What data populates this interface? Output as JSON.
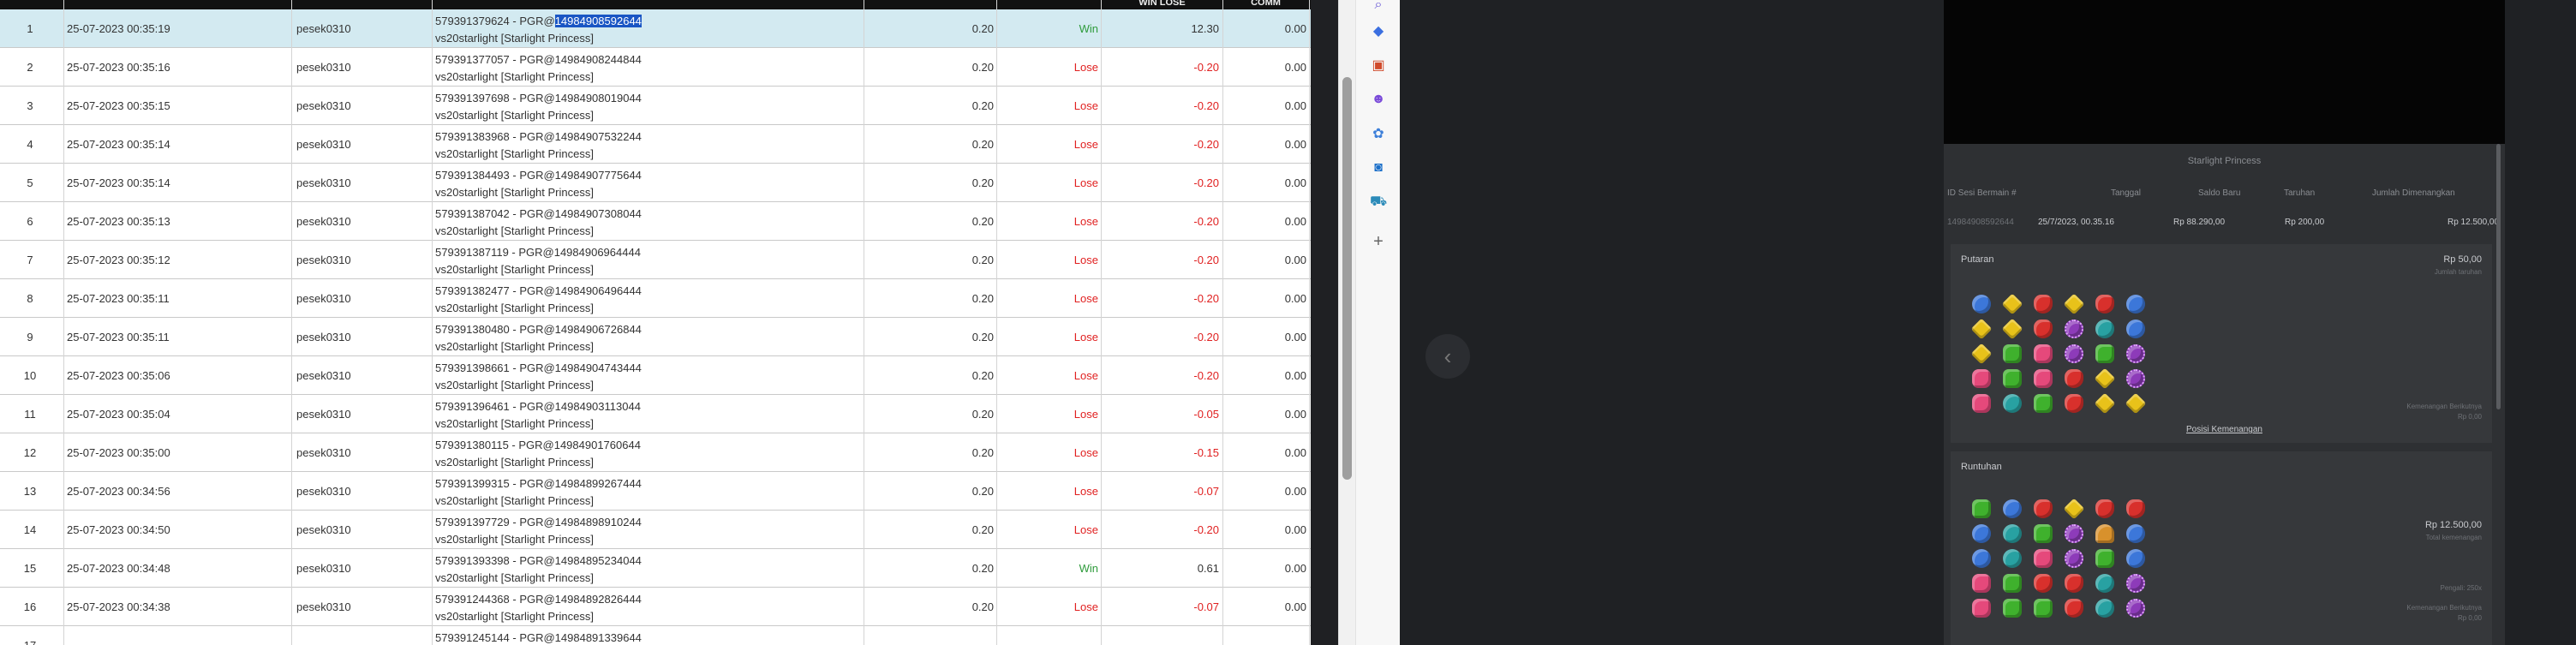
{
  "table": {
    "headers": [
      "",
      "",
      "",
      "",
      "",
      "",
      "WIN LOSE",
      "COMM"
    ],
    "rows": [
      {
        "no": "1",
        "date": "25-07-2023 00:35:19",
        "user": "pesek0310",
        "desc_prefix": "579391379624 - PGR@",
        "desc_highlight": "14984908592644",
        "desc_line2": "vs20starlight [Starlight Princess]",
        "bet": "0.20",
        "status": "Win",
        "winlose": "12.30",
        "comm": "0.00",
        "selected": true
      },
      {
        "no": "2",
        "date": "25-07-2023 00:35:16",
        "user": "pesek0310",
        "desc_prefix": "579391377057 - PGR@14984908244844",
        "desc_highlight": "",
        "desc_line2": "vs20starlight [Starlight Princess]",
        "bet": "0.20",
        "status": "Lose",
        "winlose": "-0.20",
        "comm": "0.00"
      },
      {
        "no": "3",
        "date": "25-07-2023 00:35:15",
        "user": "pesek0310",
        "desc_prefix": "579391397698 - PGR@14984908019044",
        "desc_highlight": "",
        "desc_line2": "vs20starlight [Starlight Princess]",
        "bet": "0.20",
        "status": "Lose",
        "winlose": "-0.20",
        "comm": "0.00"
      },
      {
        "no": "4",
        "date": "25-07-2023 00:35:14",
        "user": "pesek0310",
        "desc_prefix": "579391383968 - PGR@14984907532244",
        "desc_highlight": "",
        "desc_line2": "vs20starlight [Starlight Princess]",
        "bet": "0.20",
        "status": "Lose",
        "winlose": "-0.20",
        "comm": "0.00"
      },
      {
        "no": "5",
        "date": "25-07-2023 00:35:14",
        "user": "pesek0310",
        "desc_prefix": "579391384493 - PGR@14984907775644",
        "desc_highlight": "",
        "desc_line2": "vs20starlight [Starlight Princess]",
        "bet": "0.20",
        "status": "Lose",
        "winlose": "-0.20",
        "comm": "0.00"
      },
      {
        "no": "6",
        "date": "25-07-2023 00:35:13",
        "user": "pesek0310",
        "desc_prefix": "579391387042 - PGR@14984907308044",
        "desc_highlight": "",
        "desc_line2": "vs20starlight [Starlight Princess]",
        "bet": "0.20",
        "status": "Lose",
        "winlose": "-0.20",
        "comm": "0.00"
      },
      {
        "no": "7",
        "date": "25-07-2023 00:35:12",
        "user": "pesek0310",
        "desc_prefix": "579391387119 - PGR@14984906964444",
        "desc_highlight": "",
        "desc_line2": "vs20starlight [Starlight Princess]",
        "bet": "0.20",
        "status": "Lose",
        "winlose": "-0.20",
        "comm": "0.00"
      },
      {
        "no": "8",
        "date": "25-07-2023 00:35:11",
        "user": "pesek0310",
        "desc_prefix": "579391382477 - PGR@14984906496444",
        "desc_highlight": "",
        "desc_line2": "vs20starlight [Starlight Princess]",
        "bet": "0.20",
        "status": "Lose",
        "winlose": "-0.20",
        "comm": "0.00"
      },
      {
        "no": "9",
        "date": "25-07-2023 00:35:11",
        "user": "pesek0310",
        "desc_prefix": "579391380480 - PGR@14984906726844",
        "desc_highlight": "",
        "desc_line2": "vs20starlight [Starlight Princess]",
        "bet": "0.20",
        "status": "Lose",
        "winlose": "-0.20",
        "comm": "0.00"
      },
      {
        "no": "10",
        "date": "25-07-2023 00:35:06",
        "user": "pesek0310",
        "desc_prefix": "579391398661 - PGR@14984904743444",
        "desc_highlight": "",
        "desc_line2": "vs20starlight [Starlight Princess]",
        "bet": "0.20",
        "status": "Lose",
        "winlose": "-0.20",
        "comm": "0.00"
      },
      {
        "no": "11",
        "date": "25-07-2023 00:35:04",
        "user": "pesek0310",
        "desc_prefix": "579391396461 - PGR@14984903113044",
        "desc_highlight": "",
        "desc_line2": "vs20starlight [Starlight Princess]",
        "bet": "0.20",
        "status": "Lose",
        "winlose": "-0.05",
        "comm": "0.00"
      },
      {
        "no": "12",
        "date": "25-07-2023 00:35:00",
        "user": "pesek0310",
        "desc_prefix": "579391380115 - PGR@14984901760644",
        "desc_highlight": "",
        "desc_line2": "vs20starlight [Starlight Princess]",
        "bet": "0.20",
        "status": "Lose",
        "winlose": "-0.15",
        "comm": "0.00"
      },
      {
        "no": "13",
        "date": "25-07-2023 00:34:56",
        "user": "pesek0310",
        "desc_prefix": "579391399315 - PGR@14984899267444",
        "desc_highlight": "",
        "desc_line2": "vs20starlight [Starlight Princess]",
        "bet": "0.20",
        "status": "Lose",
        "winlose": "-0.07",
        "comm": "0.00"
      },
      {
        "no": "14",
        "date": "25-07-2023 00:34:50",
        "user": "pesek0310",
        "desc_prefix": "579391397729 - PGR@14984898910244",
        "desc_highlight": "",
        "desc_line2": "vs20starlight [Starlight Princess]",
        "bet": "0.20",
        "status": "Lose",
        "winlose": "-0.20",
        "comm": "0.00"
      },
      {
        "no": "15",
        "date": "25-07-2023 00:34:48",
        "user": "pesek0310",
        "desc_prefix": "579391393398 - PGR@14984895234044",
        "desc_highlight": "",
        "desc_line2": "vs20starlight [Starlight Princess]",
        "bet": "0.20",
        "status": "Win",
        "winlose": "0.61",
        "comm": "0.00"
      },
      {
        "no": "16",
        "date": "25-07-2023 00:34:38",
        "user": "pesek0310",
        "desc_prefix": "579391244368 - PGR@14984892826444",
        "desc_highlight": "",
        "desc_line2": "vs20starlight [Starlight Princess]",
        "bet": "0.20",
        "status": "Lose",
        "winlose": "-0.07",
        "comm": "0.00"
      },
      {
        "no": "17",
        "date": "",
        "user": "",
        "desc_prefix": "579391245144 - PGR@14984891339644",
        "desc_highlight": "",
        "desc_line2": "",
        "bet": "",
        "status": "",
        "winlose": "",
        "comm": ""
      }
    ]
  },
  "sidebar_icons": [
    "search-icon",
    "tag-icon",
    "toolbox-icon",
    "people-icon",
    "settings-icon",
    "outlook-icon",
    "cart-icon",
    "add-icon"
  ],
  "game": {
    "title": "Starlight Princess",
    "headers": {
      "id": "ID Sesi Bermain #",
      "date": "Tanggal",
      "balance": "Saldo Baru",
      "bet": "Taruhan",
      "win": "Jumlah Dimenangkan"
    },
    "values": {
      "id": "14984908592644",
      "date": "25/7/2023, 00.35.16",
      "balance": "Rp 88.290,00",
      "bet": "Rp 200,00",
      "win": "Rp 12.500,00"
    },
    "spin_label": "Putaran",
    "spin_amount": "Rp 50,00",
    "spin_note": "Jumlah taruhan",
    "spin_footnote_1": "Kemenangan Berikutnya",
    "spin_footnote_2": "Rp 0,00",
    "win_positions_link": "Posisi Kemenangan",
    "tumble_label": "Runtuhan",
    "tumble_amount": "Rp 12.500,00",
    "tumble_note": "Total kemenangan",
    "tumble_footnote_1": "Pengali: 250x",
    "tumble_footnote_2": "Kemenangan Berikutnya",
    "tumble_footnote_3": "Rp 0,00",
    "grid1": [
      "blue",
      "yellow",
      "red",
      "yellow",
      "red",
      "blue",
      "yellow",
      "yellow",
      "red",
      "purple",
      "teal",
      "blue",
      "yellow",
      "green",
      "pink",
      "purple",
      "green",
      "purple",
      "pink",
      "green",
      "pink",
      "red",
      "yellow",
      "purple",
      "pink",
      "teal",
      "green",
      "red",
      "yellow",
      "yellow"
    ],
    "grid2": [
      "green",
      "blue",
      "red",
      "yellow",
      "red",
      "red",
      "blue",
      "teal",
      "green",
      "purple",
      "wing",
      "blue",
      "blue",
      "teal",
      "pink",
      "purple",
      "green",
      "blue",
      "pink",
      "green",
      "red",
      "red",
      "teal",
      "purple",
      "pink",
      "green",
      "green",
      "red",
      "teal",
      "purple"
    ]
  },
  "colors": {
    "win": "#2e9b3b",
    "lose": "#e02020",
    "selection": "#1a56c4",
    "row_selected": "#d3eaf1"
  }
}
